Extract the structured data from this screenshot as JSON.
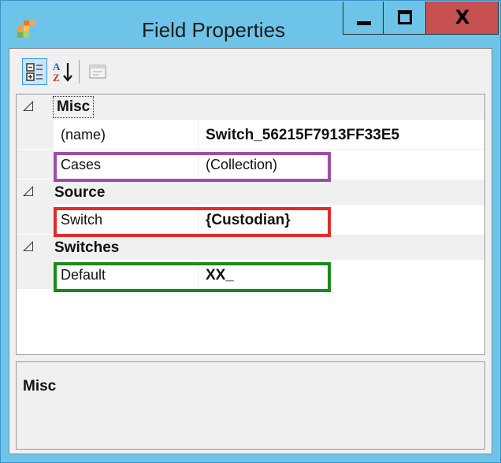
{
  "window": {
    "title": "Field Properties",
    "controls": {
      "minimize": "minimize",
      "maximize": "maximize",
      "close": "X"
    }
  },
  "toolbar": {
    "buttons": [
      {
        "name": "categorized",
        "icon": "categorized-view-icon",
        "active": true
      },
      {
        "name": "alphabetical",
        "icon": "sort-az-icon",
        "active": false
      },
      {
        "name": "property-pages",
        "icon": "property-pages-icon",
        "active": false,
        "disabled": true
      }
    ]
  },
  "grid": {
    "categories": [
      {
        "name": "Misc",
        "expanded_glyph": "◿",
        "properties": [
          {
            "name": "(name)",
            "value": "Switch_56215F7913FF33E5",
            "bold": true
          },
          {
            "name": "Cases",
            "value": "(Collection)",
            "bold": false
          }
        ]
      },
      {
        "name": "Source",
        "expanded_glyph": "◿",
        "properties": [
          {
            "name": "Switch",
            "value": "{Custodian}",
            "bold": true
          }
        ]
      },
      {
        "name": "Switches",
        "expanded_glyph": "◿",
        "properties": [
          {
            "name": "Default",
            "value": "XX_",
            "bold": true
          }
        ]
      }
    ]
  },
  "description": {
    "title": "Misc"
  },
  "colors": {
    "titlebar": "#6dc4e8",
    "close_button": "#c75050",
    "highlight_cases": "#a14ca6",
    "highlight_switch": "#e52a2a",
    "highlight_default": "#1a8a1a"
  }
}
